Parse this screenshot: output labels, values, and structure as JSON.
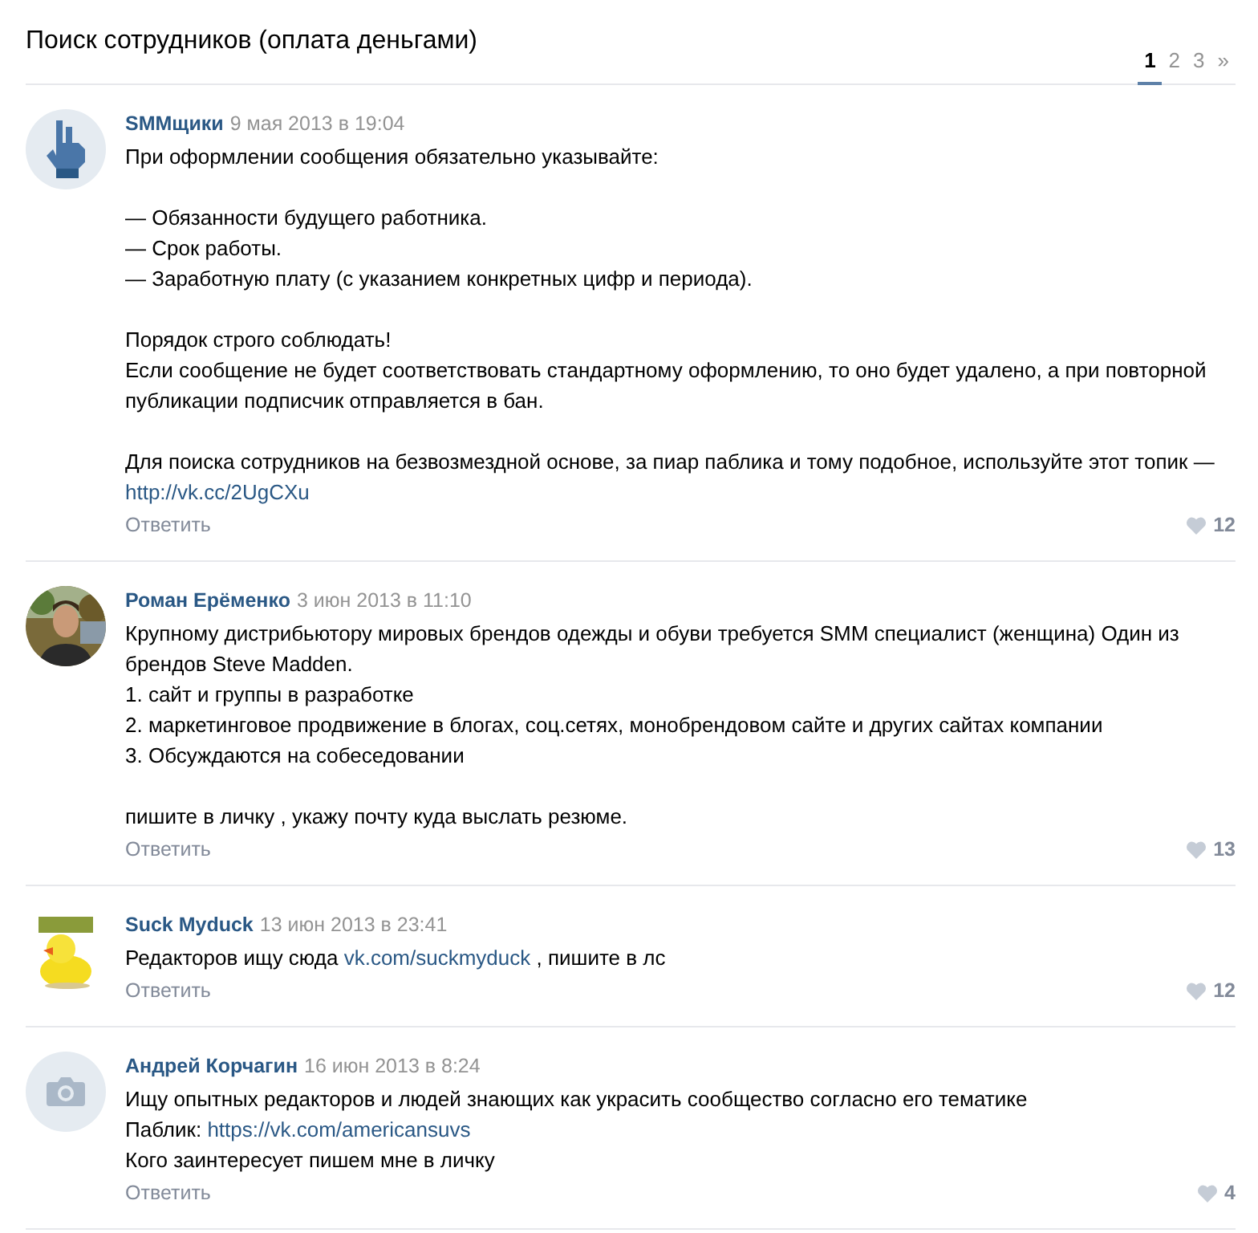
{
  "title": "Поиск сотрудников (оплата деньгами)",
  "pages": [
    {
      "label": "1",
      "selected": true
    },
    {
      "label": "2",
      "selected": false
    },
    {
      "label": "3",
      "selected": false
    },
    {
      "label": "»",
      "selected": false
    }
  ],
  "posts": [
    {
      "author": "SMMщики",
      "date": "9 мая 2013 в 19:04",
      "avatar": {
        "kind": "hand"
      },
      "reply": "Ответить",
      "likes": "12",
      "paragraphs": [
        {
          "lines": [
            [
              {
                "kind": "text",
                "text": "При оформлении сообщения обязательно указывайте:"
              }
            ]
          ]
        },
        {
          "lines": [
            [
              {
                "kind": "text",
                "text": "— Обязанности будущего работника."
              }
            ],
            [
              {
                "kind": "text",
                "text": "— Срок работы."
              }
            ],
            [
              {
                "kind": "text",
                "text": "— Заработную плату (с указанием конкретных цифр и периода)."
              }
            ]
          ]
        },
        {
          "lines": [
            [
              {
                "kind": "text",
                "text": "Порядок строго соблюдать!"
              }
            ],
            [
              {
                "kind": "text",
                "text": "Если сообщение не будет соответствовать стандартному оформлению, то оно будет удалено, а при повторной публикации подписчик отправляется в бан."
              }
            ]
          ]
        },
        {
          "lines": [
            [
              {
                "kind": "text",
                "text": "Для поиска сотрудников на безвозмездной основе, за пиар паблика и тому подобное, используйте этот топик —"
              }
            ],
            [
              {
                "kind": "link",
                "text": "http://vk.cc/2UgCXu"
              }
            ]
          ]
        }
      ]
    },
    {
      "author": "Роман Ерёменко",
      "date": "3 июн 2013 в 11:10",
      "avatar": {
        "kind": "picture"
      },
      "reply": "Ответить",
      "likes": "13",
      "paragraphs": [
        {
          "lines": [
            [
              {
                "kind": "text",
                "text": "Крупному дистрибьютору мировых брендов одежды и обуви требуется SMM специалист (женщина) Один из брендов Steve Madden."
              }
            ],
            [
              {
                "kind": "text",
                "text": "1. сайт и группы в разработке"
              }
            ],
            [
              {
                "kind": "text",
                "text": "2. маркетинговое продвижение в блогах, соц.сетях, монобрендовом сайте и других сайтах компании"
              }
            ],
            [
              {
                "kind": "text",
                "text": "3. Обсуждаются на собеседовании"
              }
            ]
          ]
        },
        {
          "lines": [
            [
              {
                "kind": "text",
                "text": "пишите в личку , укажу почту куда выслать резюме."
              }
            ]
          ]
        }
      ]
    },
    {
      "author": "Suck Myduck",
      "date": "13 июн 2013 в 23:41",
      "avatar": {
        "kind": "duck"
      },
      "reply": "Ответить",
      "likes": "12",
      "paragraphs": [
        {
          "lines": [
            [
              {
                "kind": "text",
                "text": "Редакторов ищу сюда "
              },
              {
                "kind": "link",
                "text": "vk.com/suckmyduck"
              },
              {
                "kind": "text",
                "text": " , пишите в лс"
              }
            ]
          ]
        }
      ]
    },
    {
      "author": "Андрей Корчагин",
      "date": "16 июн 2013 в 8:24",
      "avatar": {
        "kind": "camera"
      },
      "reply": "Ответить",
      "likes": "4",
      "paragraphs": [
        {
          "lines": [
            [
              {
                "kind": "text",
                "text": "Ищу опытных редакторов и людей знающих как украсить сообщество согласно его тематике"
              }
            ],
            [
              {
                "kind": "text",
                "text": "Паблик: "
              },
              {
                "kind": "link",
                "text": "https://vk.com/americansuvs"
              }
            ],
            [
              {
                "kind": "text",
                "text": "Кого заинтересует пишем мне в личку"
              }
            ]
          ]
        }
      ]
    }
  ]
}
